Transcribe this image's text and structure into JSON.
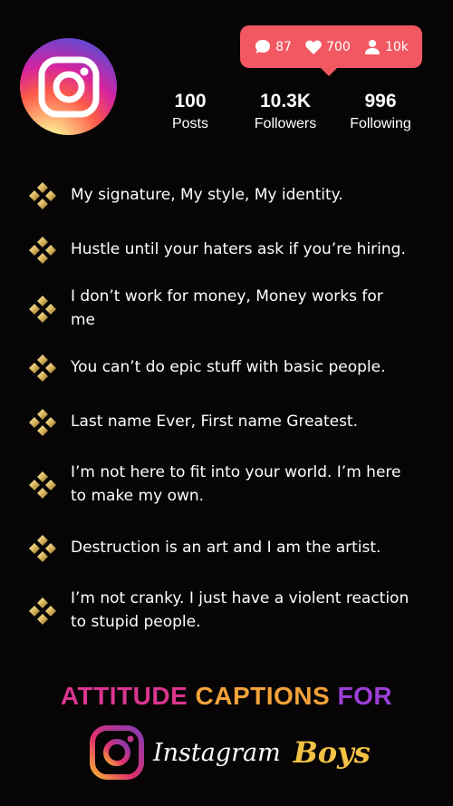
{
  "header": {
    "logo_icon": "instagram-logo-icon",
    "notification": {
      "comments": "87",
      "likes": "700",
      "followers": "10k"
    },
    "stats": [
      {
        "value": "100",
        "label": "Posts"
      },
      {
        "value": "10.3K",
        "label": "Followers"
      },
      {
        "value": "996",
        "label": "Following"
      }
    ]
  },
  "captions": [
    {
      "line1": "My signature, My style, My identity.",
      "line2": ""
    },
    {
      "line1": "Hustle until your haters ask if you’re hiring.",
      "line2": ""
    },
    {
      "line1": "I don’t work for money, Money works for",
      "line2": "me"
    },
    {
      "line1": "You can’t do epic stuff with basic people.",
      "line2": ""
    },
    {
      "line1": "Last name Ever, First name Greatest.",
      "line2": ""
    },
    {
      "line1": "I’m not here to fit into your world. I’m here",
      "line2": "to make my own."
    },
    {
      "line1": "Destruction is an art and I am the artist.",
      "line2": ""
    },
    {
      "line1": "I’m not cranky. I just have a violent reaction",
      "line2": "to stupid people."
    }
  ],
  "footer": {
    "word1": "ATTITUDE",
    "word2": "CAPTIONS",
    "word3": "FOR",
    "brand": "Instagram",
    "suffix": "Boys"
  },
  "colors": {
    "background": "#060404",
    "notification": "#f25861",
    "gold": "#d8b45c",
    "pink": "#d9358f",
    "orange": "#f2a23a",
    "purple": "#9b3fd6"
  }
}
